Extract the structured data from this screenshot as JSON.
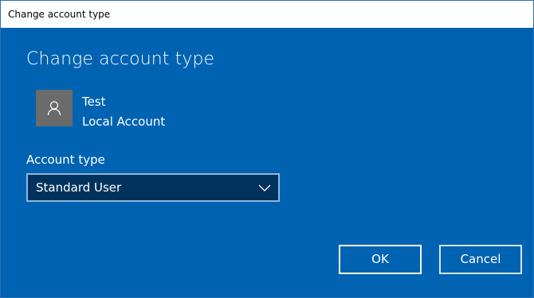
{
  "window": {
    "title": "Change account type"
  },
  "dialog": {
    "heading": "Change account type",
    "user": {
      "name": "Test",
      "account_kind": "Local Account",
      "avatar_icon": "user-silhouette-icon"
    },
    "account_type": {
      "label": "Account type",
      "selected": "Standard User"
    },
    "buttons": {
      "ok": "OK",
      "cancel": "Cancel"
    }
  },
  "colors": {
    "background": "#0063b1",
    "select_background": "#00325d",
    "select_border": "#8fb7dc",
    "avatar_background": "#6b6b6b",
    "text": "#ffffff"
  }
}
